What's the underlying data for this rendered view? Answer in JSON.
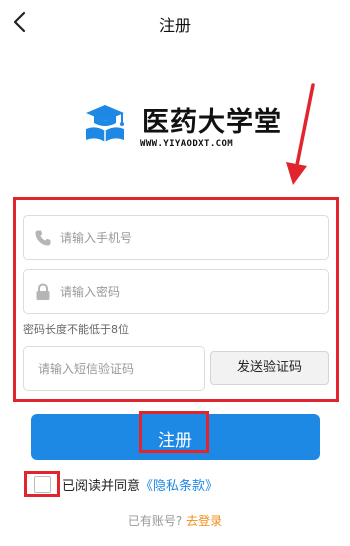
{
  "header": {
    "title": "注册",
    "back_icon": "chevron-left-icon"
  },
  "brand": {
    "name": "医药大学堂",
    "url": "WWW.YIYAODXT.COM",
    "icon": "graduation-cap-book-icon",
    "icon_color": "#1e88e5"
  },
  "form": {
    "phone_placeholder": "请输入手机号",
    "phone_icon": "phone-icon",
    "password_placeholder": "请输入密码",
    "password_icon": "lock-icon",
    "password_hint": "密码长度不能低于8位",
    "sms_placeholder": "请输入短信验证码",
    "send_code_label": "发送验证码"
  },
  "actions": {
    "register_label": "注册",
    "primary_color": "#1e88e5"
  },
  "agreement": {
    "text": "已阅读并同意",
    "link": "《隐私条款》",
    "checked": false
  },
  "footer": {
    "prompt": "已有账号?",
    "login_link": "去登录",
    "link_color": "#f08c1a"
  },
  "annotations": {
    "highlight_color": "#e0252e"
  }
}
